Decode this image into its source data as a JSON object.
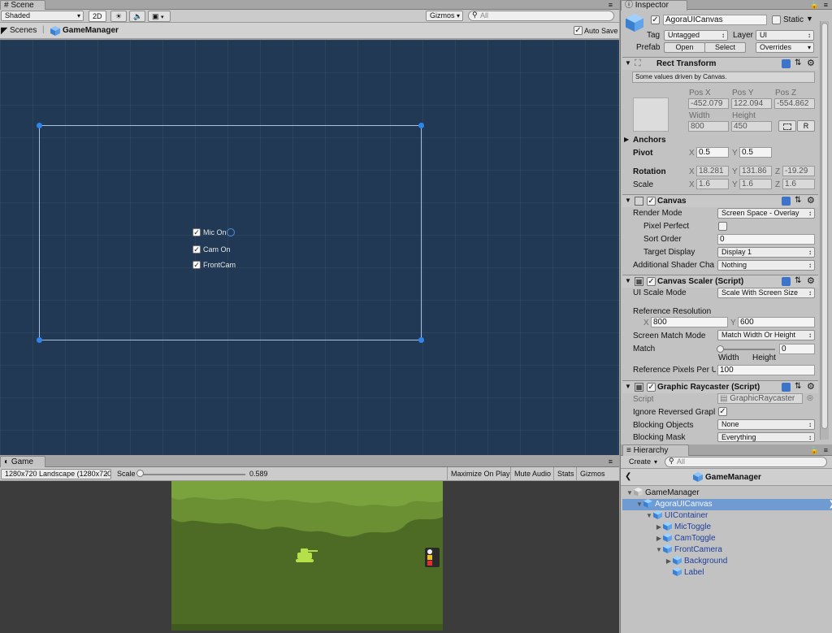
{
  "scene": {
    "tab": "Scene",
    "shading_mode": "Shaded",
    "mode_2d": "2D",
    "gizmos": "Gizmos",
    "search_placeholder": "All",
    "breadcrumb_root": "Scenes",
    "breadcrumb_current": "GameManager",
    "auto_save": "Auto Save",
    "ui_toggles": [
      {
        "label": "Mic On",
        "checked": true
      },
      {
        "label": "Cam On",
        "checked": true
      },
      {
        "label": "FrontCam",
        "checked": true
      }
    ]
  },
  "game": {
    "tab": "Game",
    "resolution": "1280x720 Landscape (1280x720",
    "scale_label": "Scale",
    "scale_value": "0.589",
    "maximize_on_play": "Maximize On Play",
    "mute_audio": "Mute Audio",
    "stats": "Stats",
    "gizmos": "Gizmos"
  },
  "inspector": {
    "tab": "Inspector",
    "object_name": "AgoraUICanvas",
    "static_label": "Static",
    "tag_label": "Tag",
    "tag_value": "Untagged",
    "layer_label": "Layer",
    "layer_value": "UI",
    "prefab_label": "Prefab",
    "open": "Open",
    "select": "Select",
    "overrides": "Overrides",
    "rect_transform": {
      "title": "Rect Transform",
      "note": "Some values driven by Canvas.",
      "pos_x_label": "Pos X",
      "pos_y_label": "Pos Y",
      "pos_z_label": "Pos Z",
      "pos_x": "-452.079",
      "pos_y": "122.094",
      "pos_z": "-554.862",
      "width_label": "Width",
      "height_label": "Height",
      "width": "800",
      "height": "450",
      "r_button": "R",
      "anchors": "Anchors",
      "pivot": "Pivot",
      "pivot_x": "0.5",
      "pivot_y": "0.5",
      "rotation": "Rotation",
      "rot_x": "18.281",
      "rot_y": "131.86",
      "rot_z": "-19.29",
      "scale": "Scale",
      "scale_x": "1.6",
      "scale_y": "1.6",
      "scale_z": "1.6",
      "x": "X",
      "y": "Y",
      "z": "Z"
    },
    "canvas": {
      "title": "Canvas",
      "render_mode_label": "Render Mode",
      "render_mode": "Screen Space - Overlay",
      "pixel_perfect_label": "Pixel Perfect",
      "sort_order_label": "Sort Order",
      "sort_order": "0",
      "target_display_label": "Target Display",
      "target_display": "Display 1",
      "shader_channels_label": "Additional Shader Cha",
      "shader_channels": "Nothing"
    },
    "canvas_scaler": {
      "title": "Canvas Scaler (Script)",
      "ui_scale_mode_label": "UI Scale Mode",
      "ui_scale_mode": "Scale With Screen Size",
      "ref_res_label": "Reference Resolution",
      "ref_x": "800",
      "ref_y": "600",
      "match_mode_label": "Screen Match Mode",
      "match_mode": "Match Width Or Height",
      "match_label": "Match",
      "match_value": "0",
      "width_caption": "Width",
      "height_caption": "Height",
      "ref_pixels_label": "Reference Pixels Per U",
      "ref_pixels": "100"
    },
    "graphic_raycaster": {
      "title": "Graphic Raycaster (Script)",
      "script_label": "Script",
      "script_value": "GraphicRaycaster",
      "ignore_reversed_label": "Ignore Reversed Grapl",
      "blocking_objects_label": "Blocking Objects",
      "blocking_objects": "None",
      "blocking_mask_label": "Blocking Mask",
      "blocking_mask": "Everything"
    }
  },
  "hierarchy": {
    "tab": "Hierarchy",
    "create": "Create",
    "search_placeholder": "All",
    "scene_title": "GameManager",
    "items": [
      {
        "label": "GameManager",
        "indent": 0,
        "arrow": "down",
        "selected": false,
        "prefab": false
      },
      {
        "label": "AgoraUICanvas",
        "indent": 1,
        "arrow": "down",
        "selected": true,
        "prefab": true
      },
      {
        "label": "UIContainer",
        "indent": 2,
        "arrow": "down",
        "selected": false,
        "prefab": true
      },
      {
        "label": "MicToggle",
        "indent": 3,
        "arrow": "right",
        "selected": false,
        "prefab": true
      },
      {
        "label": "CamToggle",
        "indent": 3,
        "arrow": "right",
        "selected": false,
        "prefab": true
      },
      {
        "label": "FrontCamera",
        "indent": 3,
        "arrow": "down",
        "selected": false,
        "prefab": true
      },
      {
        "label": "Background",
        "indent": 4,
        "arrow": "right",
        "selected": false,
        "prefab": true
      },
      {
        "label": "Label",
        "indent": 4,
        "arrow": "none",
        "selected": false,
        "prefab": true
      }
    ]
  },
  "colors": {
    "scene_bg": "#213955",
    "game_bg": "#4d6b25",
    "selection": "#6f9ad2",
    "prefab_text": "#1e3f9e"
  }
}
